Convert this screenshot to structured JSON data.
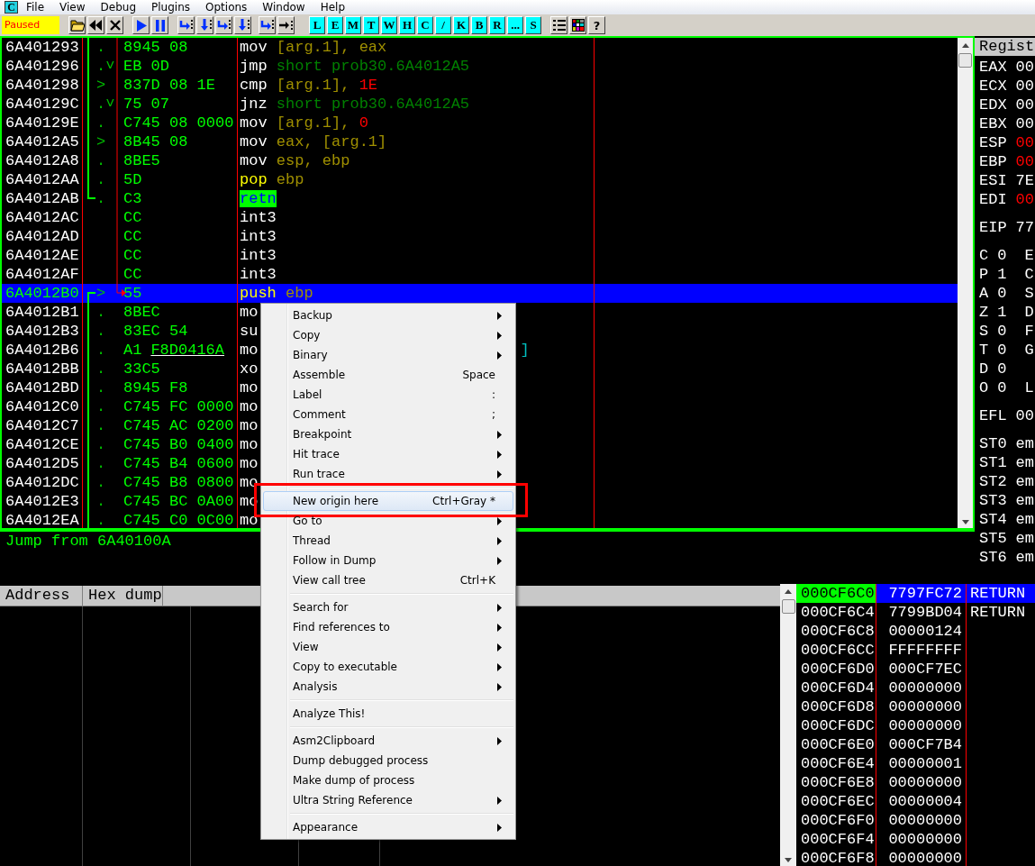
{
  "app": {
    "icon_letter": "C"
  },
  "menu_bar": [
    "File",
    "View",
    "Debug",
    "Plugins",
    "Options",
    "Window",
    "Help"
  ],
  "toolbar": {
    "status": "Paused",
    "letter_buttons": [
      "L",
      "E",
      "M",
      "T",
      "W",
      "H",
      "C",
      "/",
      "K",
      "B",
      "R",
      "...",
      "S"
    ],
    "help_button": "?"
  },
  "disassembly": {
    "rows": [
      {
        "address": "6A401293",
        "mark": ".",
        "hex": "8945 08",
        "tokens": [
          {
            "text": "mov",
            "kind": "op"
          },
          {
            "text": "[arg.1], eax",
            "kind": "arg"
          }
        ],
        "selected": false
      },
      {
        "address": "6A401296",
        "mark": ".˅",
        "hex": "EB 0D",
        "tokens": [
          {
            "text": "jmp",
            "kind": "op"
          },
          {
            "text": "short prob30.6A4012A5",
            "kind": "jump"
          }
        ],
        "selected": false
      },
      {
        "address": "6A401298",
        "mark": ">",
        "hex": "837D 08 1E",
        "tokens": [
          {
            "text": "cmp",
            "kind": "op"
          },
          {
            "text": "[arg.1],",
            "kind": "arg"
          },
          {
            "text": "1E",
            "kind": "const"
          }
        ],
        "selected": false
      },
      {
        "address": "6A40129C",
        "mark": ".˅",
        "hex": "75 07",
        "tokens": [
          {
            "text": "jnz",
            "kind": "op"
          },
          {
            "text": "short prob30.6A4012A5",
            "kind": "jump"
          }
        ],
        "selected": false
      },
      {
        "address": "6A40129E",
        "mark": ".",
        "hex": "C745 08 0000",
        "tokens": [
          {
            "text": "mov",
            "kind": "op"
          },
          {
            "text": "[arg.1],",
            "kind": "arg"
          },
          {
            "text": "0",
            "kind": "const"
          }
        ],
        "selected": false
      },
      {
        "address": "6A4012A5",
        "mark": ">",
        "hex": "8B45 08",
        "tokens": [
          {
            "text": "mov",
            "kind": "op"
          },
          {
            "text": "eax, [arg.1]",
            "kind": "arg"
          }
        ],
        "selected": false
      },
      {
        "address": "6A4012A8",
        "mark": ".",
        "hex": "8BE5",
        "tokens": [
          {
            "text": "mov",
            "kind": "op"
          },
          {
            "text": "esp, ebp",
            "kind": "arg"
          }
        ],
        "selected": false
      },
      {
        "address": "6A4012AA",
        "mark": ".",
        "hex": "5D",
        "tokens": [
          {
            "text": "pop",
            "kind": "stack"
          },
          {
            "text": "ebp",
            "kind": "arg"
          }
        ],
        "selected": false
      },
      {
        "address": "6A4012AB",
        "mark": ".",
        "hex": "C3",
        "tokens": [
          {
            "text": "retn",
            "kind": "ret"
          }
        ],
        "selected": false
      },
      {
        "address": "6A4012AC",
        "hex": "CC",
        "tokens": [
          {
            "text": "int3",
            "kind": "op"
          }
        ],
        "selected": false
      },
      {
        "address": "6A4012AD",
        "hex": "CC",
        "tokens": [
          {
            "text": "int3",
            "kind": "op"
          }
        ],
        "selected": false
      },
      {
        "address": "6A4012AE",
        "hex": "CC",
        "tokens": [
          {
            "text": "int3",
            "kind": "op"
          }
        ],
        "selected": false
      },
      {
        "address": "6A4012AF",
        "hex": "CC",
        "tokens": [
          {
            "text": "int3",
            "kind": "op"
          }
        ],
        "selected": false
      },
      {
        "address": "6A4012B0",
        "mark": ">",
        "hex": "55",
        "tokens": [
          {
            "text": "push",
            "kind": "stack"
          },
          {
            "text": "ebp",
            "kind": "arg"
          }
        ],
        "selected": true
      },
      {
        "address": "6A4012B1",
        "mark": ".",
        "hex": "8BEC",
        "tokens": [
          {
            "text": "mo",
            "kind": "op"
          }
        ],
        "selected": false
      },
      {
        "address": "6A4012B3",
        "mark": ".",
        "hex": "83EC 54",
        "tokens": [
          {
            "text": "su",
            "kind": "op"
          }
        ],
        "selected": false
      },
      {
        "address": "6A4012B6",
        "mark": ".",
        "hex": "A1",
        "hex_link": "F8D0416A",
        "tokens": [
          {
            "text": "mo",
            "kind": "op"
          }
        ],
        "tail": "]",
        "selected": false
      },
      {
        "address": "6A4012BB",
        "mark": ".",
        "hex": "33C5",
        "tokens": [
          {
            "text": "xo",
            "kind": "op"
          }
        ],
        "selected": false
      },
      {
        "address": "6A4012BD",
        "mark": ".",
        "hex": "8945 F8",
        "tokens": [
          {
            "text": "mo",
            "kind": "op"
          }
        ],
        "selected": false
      },
      {
        "address": "6A4012C0",
        "mark": ".",
        "hex": "C745 FC 0000",
        "tokens": [
          {
            "text": "mo",
            "kind": "op"
          }
        ],
        "selected": false
      },
      {
        "address": "6A4012C7",
        "mark": ".",
        "hex": "C745 AC 0200",
        "tokens": [
          {
            "text": "mo",
            "kind": "op"
          }
        ],
        "selected": false
      },
      {
        "address": "6A4012CE",
        "mark": ".",
        "hex": "C745 B0 0400",
        "tokens": [
          {
            "text": "mo",
            "kind": "op"
          }
        ],
        "selected": false
      },
      {
        "address": "6A4012D5",
        "mark": ".",
        "hex": "C745 B4 0600",
        "tokens": [
          {
            "text": "mo",
            "kind": "op"
          }
        ],
        "selected": false
      },
      {
        "address": "6A4012DC",
        "mark": ".",
        "hex": "C745 B8 0800",
        "tokens": [
          {
            "text": "mo",
            "kind": "op"
          }
        ],
        "selected": false
      },
      {
        "address": "6A4012E3",
        "mark": ".",
        "hex": "C745 BC 0A00",
        "tokens": [
          {
            "text": "mo",
            "kind": "op"
          }
        ],
        "selected": false
      },
      {
        "address": "6A4012EA",
        "mark": ".",
        "hex": "C745 C0 0C00",
        "tokens": [
          {
            "text": "mo",
            "kind": "op"
          }
        ],
        "selected": false
      }
    ],
    "info": "Jump from 6A40100A"
  },
  "registers": {
    "title": "Regist",
    "groups": [
      [
        {
          "name": "EAX",
          "value": "00",
          "changed": false
        },
        {
          "name": "ECX",
          "value": "00",
          "changed": false
        },
        {
          "name": "EDX",
          "value": "00",
          "changed": false
        },
        {
          "name": "EBX",
          "value": "00",
          "changed": false
        },
        {
          "name": "ESP",
          "value": "00",
          "changed": true
        },
        {
          "name": "EBP",
          "value": "00",
          "changed": true
        },
        {
          "name": "ESI",
          "value": "7E",
          "changed": false
        },
        {
          "name": "EDI",
          "value": "00",
          "changed": true
        }
      ],
      [
        {
          "name": "EIP",
          "value": "77"
        }
      ],
      [
        {
          "name": "C",
          "value": "0",
          "segment": "E"
        },
        {
          "name": "P",
          "value": "1",
          "segment": "C"
        },
        {
          "name": "A",
          "value": "0",
          "segment": "S"
        },
        {
          "name": "Z",
          "value": "1",
          "segment": "D"
        },
        {
          "name": "S",
          "value": "0",
          "segment": "F"
        },
        {
          "name": "T",
          "value": "0",
          "segment": "G"
        },
        {
          "name": "D",
          "value": "0"
        },
        {
          "name": "O",
          "value": "0",
          "segment": "L"
        }
      ],
      [
        {
          "name": "EFL",
          "value": "00"
        }
      ],
      [
        {
          "name": "ST0",
          "value": "em"
        },
        {
          "name": "ST1",
          "value": "em"
        },
        {
          "name": "ST2",
          "value": "em"
        },
        {
          "name": "ST3",
          "value": "em"
        },
        {
          "name": "ST4",
          "value": "em"
        },
        {
          "name": "ST5",
          "value": "em"
        },
        {
          "name": "ST6",
          "value": "em"
        }
      ]
    ]
  },
  "dump": {
    "columns": [
      "Address",
      "Hex dump"
    ]
  },
  "stack": {
    "rows": [
      {
        "address": "000CF6C0",
        "value": "7797FC72",
        "comment": "RETURN",
        "selected": true
      },
      {
        "address": "000CF6C4",
        "value": "7799BD04",
        "comment": "RETURN",
        "selected": false
      },
      {
        "address": "000CF6C8",
        "value": "00000124",
        "selected": false
      },
      {
        "address": "000CF6CC",
        "value": "FFFFFFFF",
        "selected": false
      },
      {
        "address": "000CF6D0",
        "value": "000CF7EC",
        "selected": false
      },
      {
        "address": "000CF6D4",
        "value": "00000000",
        "selected": false
      },
      {
        "address": "000CF6D8",
        "value": "00000000",
        "selected": false
      },
      {
        "address": "000CF6DC",
        "value": "00000000",
        "selected": false
      },
      {
        "address": "000CF6E0",
        "value": "000CF7B4",
        "selected": false
      },
      {
        "address": "000CF6E4",
        "value": "00000001",
        "selected": false
      },
      {
        "address": "000CF6E8",
        "value": "00000000",
        "selected": false
      },
      {
        "address": "000CF6EC",
        "value": "00000004",
        "selected": false
      },
      {
        "address": "000CF6F0",
        "value": "00000000",
        "selected": false
      },
      {
        "address": "000CF6F4",
        "value": "00000000",
        "selected": false
      },
      {
        "address": "000CF6F8",
        "value": "00000000",
        "selected": false
      }
    ]
  },
  "context_menu": {
    "items": [
      {
        "kind": "item",
        "label": "Backup",
        "submenu": true,
        "highlighted": false
      },
      {
        "kind": "item",
        "label": "Copy",
        "submenu": true,
        "highlighted": false
      },
      {
        "kind": "item",
        "label": "Binary",
        "submenu": true,
        "highlighted": false
      },
      {
        "kind": "item",
        "label": "Assemble",
        "shortcut": "Space",
        "submenu": false,
        "highlighted": false
      },
      {
        "kind": "item",
        "label": "Label",
        "shortcut": ":",
        "submenu": false,
        "highlighted": false
      },
      {
        "kind": "item",
        "label": "Comment",
        "shortcut": ";",
        "submenu": false,
        "highlighted": false
      },
      {
        "kind": "item",
        "label": "Breakpoint",
        "submenu": true,
        "highlighted": false
      },
      {
        "kind": "item",
        "label": "Hit trace",
        "submenu": true,
        "highlighted": false
      },
      {
        "kind": "item",
        "label": "Run trace",
        "submenu": true,
        "highlighted": false
      },
      {
        "kind": "separator"
      },
      {
        "kind": "item",
        "label": "New origin here",
        "shortcut": "Ctrl+Gray *",
        "submenu": false,
        "highlighted": true,
        "annotated": true
      },
      {
        "kind": "item",
        "label": "Go to",
        "submenu": true,
        "highlighted": false
      },
      {
        "kind": "item",
        "label": "Thread",
        "submenu": true,
        "highlighted": false
      },
      {
        "kind": "item",
        "label": "Follow in Dump",
        "submenu": true,
        "highlighted": false
      },
      {
        "kind": "item",
        "label": "View call tree",
        "shortcut": "Ctrl+K",
        "submenu": false,
        "highlighted": false
      },
      {
        "kind": "separator"
      },
      {
        "kind": "item",
        "label": "Search for",
        "submenu": true,
        "highlighted": false
      },
      {
        "kind": "item",
        "label": "Find references to",
        "submenu": true,
        "highlighted": false
      },
      {
        "kind": "item",
        "label": "View",
        "submenu": true,
        "highlighted": false
      },
      {
        "kind": "item",
        "label": "Copy to executable",
        "submenu": true,
        "highlighted": false
      },
      {
        "kind": "item",
        "label": "Analysis",
        "submenu": true,
        "highlighted": false
      },
      {
        "kind": "separator"
      },
      {
        "kind": "item",
        "label": "Analyze This!",
        "submenu": false,
        "highlighted": false
      },
      {
        "kind": "separator"
      },
      {
        "kind": "item",
        "label": "Asm2Clipboard",
        "submenu": true,
        "highlighted": false
      },
      {
        "kind": "item",
        "label": "Dump debugged process",
        "submenu": false,
        "highlighted": false
      },
      {
        "kind": "item",
        "label": "Make dump of process",
        "submenu": false,
        "highlighted": false
      },
      {
        "kind": "item",
        "label": "Ultra String Reference",
        "submenu": true,
        "highlighted": false
      },
      {
        "kind": "separator"
      },
      {
        "kind": "item",
        "label": "Appearance",
        "submenu": true,
        "highlighted": false
      }
    ]
  }
}
